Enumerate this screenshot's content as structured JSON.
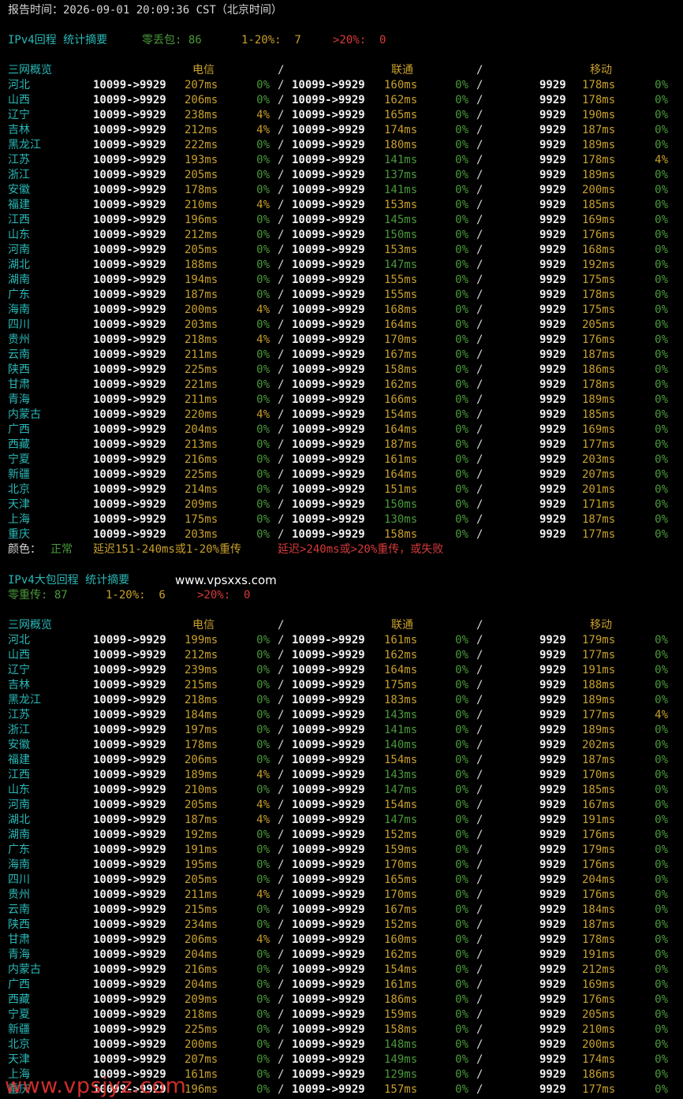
{
  "report_time": "报告时间：2026-09-01 20:09:36 CST（北京时间）",
  "legend": {
    "label": "颜色：",
    "normal": "正常",
    "mid": "延迟151-240ms或1-20%重传",
    "bad": "延迟>240ms或>20%重传，或失败"
  },
  "site_text": "www.vpsxxs.com",
  "watermark": "www.vpsjyz.com",
  "sections": [
    {
      "title": "IPv4回程 统计摘要",
      "summary_inline": true,
      "summary": [
        {
          "text": "零丢包: 86",
          "color": "g"
        },
        {
          "text": "1-20%:  7",
          "color": "y"
        },
        {
          "text": ">20%:  0",
          "color": "r"
        }
      ],
      "header": {
        "name": "三网概览",
        "ct": "电信",
        "sep1": "/",
        "cu": "联通",
        "sep2": "/",
        "cm": "移动"
      },
      "rows": [
        [
          "河北",
          "10099->9929",
          "207ms",
          "0%",
          "10099->9929",
          "160ms",
          "0%",
          "9929",
          "178ms",
          "0%"
        ],
        [
          "山西",
          "10099->9929",
          "206ms",
          "0%",
          "10099->9929",
          "162ms",
          "0%",
          "9929",
          "178ms",
          "0%"
        ],
        [
          "辽宁",
          "10099->9929",
          "238ms",
          "4%",
          "10099->9929",
          "165ms",
          "0%",
          "9929",
          "190ms",
          "0%"
        ],
        [
          "吉林",
          "10099->9929",
          "212ms",
          "4%",
          "10099->9929",
          "174ms",
          "0%",
          "9929",
          "187ms",
          "0%"
        ],
        [
          "黑龙江",
          "10099->9929",
          "222ms",
          "0%",
          "10099->9929",
          "180ms",
          "0%",
          "9929",
          "189ms",
          "0%"
        ],
        [
          "江苏",
          "10099->9929",
          "193ms",
          "0%",
          "10099->9929",
          "141ms",
          "0%",
          "9929",
          "178ms",
          "4%"
        ],
        [
          "浙江",
          "10099->9929",
          "205ms",
          "0%",
          "10099->9929",
          "137ms",
          "0%",
          "9929",
          "189ms",
          "0%"
        ],
        [
          "安徽",
          "10099->9929",
          "178ms",
          "0%",
          "10099->9929",
          "141ms",
          "0%",
          "9929",
          "200ms",
          "0%"
        ],
        [
          "福建",
          "10099->9929",
          "210ms",
          "4%",
          "10099->9929",
          "153ms",
          "0%",
          "9929",
          "185ms",
          "0%"
        ],
        [
          "江西",
          "10099->9929",
          "196ms",
          "0%",
          "10099->9929",
          "145ms",
          "0%",
          "9929",
          "169ms",
          "0%"
        ],
        [
          "山东",
          "10099->9929",
          "212ms",
          "0%",
          "10099->9929",
          "150ms",
          "0%",
          "9929",
          "176ms",
          "0%"
        ],
        [
          "河南",
          "10099->9929",
          "205ms",
          "0%",
          "10099->9929",
          "153ms",
          "0%",
          "9929",
          "168ms",
          "0%"
        ],
        [
          "湖北",
          "10099->9929",
          "188ms",
          "0%",
          "10099->9929",
          "147ms",
          "0%",
          "9929",
          "192ms",
          "0%"
        ],
        [
          "湖南",
          "10099->9929",
          "194ms",
          "0%",
          "10099->9929",
          "155ms",
          "0%",
          "9929",
          "175ms",
          "0%"
        ],
        [
          "广东",
          "10099->9929",
          "187ms",
          "0%",
          "10099->9929",
          "155ms",
          "0%",
          "9929",
          "178ms",
          "0%"
        ],
        [
          "海南",
          "10099->9929",
          "200ms",
          "4%",
          "10099->9929",
          "168ms",
          "0%",
          "9929",
          "175ms",
          "0%"
        ],
        [
          "四川",
          "10099->9929",
          "203ms",
          "0%",
          "10099->9929",
          "164ms",
          "0%",
          "9929",
          "205ms",
          "0%"
        ],
        [
          "贵州",
          "10099->9929",
          "218ms",
          "4%",
          "10099->9929",
          "170ms",
          "0%",
          "9929",
          "176ms",
          "0%"
        ],
        [
          "云南",
          "10099->9929",
          "211ms",
          "0%",
          "10099->9929",
          "167ms",
          "0%",
          "9929",
          "187ms",
          "0%"
        ],
        [
          "陕西",
          "10099->9929",
          "225ms",
          "0%",
          "10099->9929",
          "158ms",
          "0%",
          "9929",
          "186ms",
          "0%"
        ],
        [
          "甘肃",
          "10099->9929",
          "221ms",
          "0%",
          "10099->9929",
          "162ms",
          "0%",
          "9929",
          "178ms",
          "0%"
        ],
        [
          "青海",
          "10099->9929",
          "211ms",
          "0%",
          "10099->9929",
          "166ms",
          "0%",
          "9929",
          "189ms",
          "0%"
        ],
        [
          "内蒙古",
          "10099->9929",
          "220ms",
          "4%",
          "10099->9929",
          "154ms",
          "0%",
          "9929",
          "185ms",
          "0%"
        ],
        [
          "广西",
          "10099->9929",
          "204ms",
          "0%",
          "10099->9929",
          "164ms",
          "0%",
          "9929",
          "169ms",
          "0%"
        ],
        [
          "西藏",
          "10099->9929",
          "213ms",
          "0%",
          "10099->9929",
          "187ms",
          "0%",
          "9929",
          "177ms",
          "0%"
        ],
        [
          "宁夏",
          "10099->9929",
          "216ms",
          "0%",
          "10099->9929",
          "161ms",
          "0%",
          "9929",
          "203ms",
          "0%"
        ],
        [
          "新疆",
          "10099->9929",
          "225ms",
          "0%",
          "10099->9929",
          "164ms",
          "0%",
          "9929",
          "207ms",
          "0%"
        ],
        [
          "北京",
          "10099->9929",
          "214ms",
          "0%",
          "10099->9929",
          "151ms",
          "0%",
          "9929",
          "201ms",
          "0%"
        ],
        [
          "天津",
          "10099->9929",
          "209ms",
          "0%",
          "10099->9929",
          "150ms",
          "0%",
          "9929",
          "171ms",
          "0%"
        ],
        [
          "上海",
          "10099->9929",
          "175ms",
          "0%",
          "10099->9929",
          "130ms",
          "0%",
          "9929",
          "187ms",
          "0%"
        ],
        [
          "重庆",
          "10099->9929",
          "203ms",
          "0%",
          "10099->9929",
          "158ms",
          "0%",
          "9929",
          "177ms",
          "0%"
        ]
      ]
    },
    {
      "title": "IPv4大包回程 统计摘要",
      "summary_inline": false,
      "summary": [
        {
          "text": "零重传: 87",
          "color": "g"
        },
        {
          "text": "1-20%:  6",
          "color": "y"
        },
        {
          "text": ">20%:  0",
          "color": "r"
        }
      ],
      "header": {
        "name": "三网概览",
        "ct": "电信",
        "sep1": "/",
        "cu": "联通",
        "sep2": "/",
        "cm": "移动"
      },
      "rows": [
        [
          "河北",
          "10099->9929",
          "199ms",
          "0%",
          "10099->9929",
          "161ms",
          "0%",
          "9929",
          "179ms",
          "0%"
        ],
        [
          "山西",
          "10099->9929",
          "212ms",
          "0%",
          "10099->9929",
          "162ms",
          "0%",
          "9929",
          "177ms",
          "0%"
        ],
        [
          "辽宁",
          "10099->9929",
          "239ms",
          "0%",
          "10099->9929",
          "164ms",
          "0%",
          "9929",
          "191ms",
          "0%"
        ],
        [
          "吉林",
          "10099->9929",
          "215ms",
          "0%",
          "10099->9929",
          "175ms",
          "0%",
          "9929",
          "188ms",
          "0%"
        ],
        [
          "黑龙江",
          "10099->9929",
          "218ms",
          "0%",
          "10099->9929",
          "183ms",
          "0%",
          "9929",
          "189ms",
          "0%"
        ],
        [
          "江苏",
          "10099->9929",
          "184ms",
          "0%",
          "10099->9929",
          "143ms",
          "0%",
          "9929",
          "177ms",
          "4%"
        ],
        [
          "浙江",
          "10099->9929",
          "197ms",
          "0%",
          "10099->9929",
          "141ms",
          "0%",
          "9929",
          "189ms",
          "0%"
        ],
        [
          "安徽",
          "10099->9929",
          "178ms",
          "0%",
          "10099->9929",
          "140ms",
          "0%",
          "9929",
          "202ms",
          "0%"
        ],
        [
          "福建",
          "10099->9929",
          "206ms",
          "0%",
          "10099->9929",
          "154ms",
          "0%",
          "9929",
          "187ms",
          "0%"
        ],
        [
          "江西",
          "10099->9929",
          "189ms",
          "4%",
          "10099->9929",
          "143ms",
          "0%",
          "9929",
          "170ms",
          "0%"
        ],
        [
          "山东",
          "10099->9929",
          "210ms",
          "0%",
          "10099->9929",
          "147ms",
          "0%",
          "9929",
          "185ms",
          "0%"
        ],
        [
          "河南",
          "10099->9929",
          "205ms",
          "4%",
          "10099->9929",
          "154ms",
          "0%",
          "9929",
          "167ms",
          "0%"
        ],
        [
          "湖北",
          "10099->9929",
          "187ms",
          "4%",
          "10099->9929",
          "147ms",
          "0%",
          "9929",
          "191ms",
          "0%"
        ],
        [
          "湖南",
          "10099->9929",
          "192ms",
          "0%",
          "10099->9929",
          "152ms",
          "0%",
          "9929",
          "176ms",
          "0%"
        ],
        [
          "广东",
          "10099->9929",
          "191ms",
          "0%",
          "10099->9929",
          "159ms",
          "0%",
          "9929",
          "179ms",
          "0%"
        ],
        [
          "海南",
          "10099->9929",
          "195ms",
          "0%",
          "10099->9929",
          "170ms",
          "0%",
          "9929",
          "176ms",
          "0%"
        ],
        [
          "四川",
          "10099->9929",
          "205ms",
          "0%",
          "10099->9929",
          "165ms",
          "0%",
          "9929",
          "204ms",
          "0%"
        ],
        [
          "贵州",
          "10099->9929",
          "211ms",
          "4%",
          "10099->9929",
          "170ms",
          "0%",
          "9929",
          "176ms",
          "0%"
        ],
        [
          "云南",
          "10099->9929",
          "215ms",
          "0%",
          "10099->9929",
          "167ms",
          "0%",
          "9929",
          "184ms",
          "0%"
        ],
        [
          "陕西",
          "10099->9929",
          "234ms",
          "0%",
          "10099->9929",
          "152ms",
          "0%",
          "9929",
          "187ms",
          "0%"
        ],
        [
          "甘肃",
          "10099->9929",
          "206ms",
          "4%",
          "10099->9929",
          "160ms",
          "0%",
          "9929",
          "178ms",
          "0%"
        ],
        [
          "青海",
          "10099->9929",
          "204ms",
          "0%",
          "10099->9929",
          "162ms",
          "0%",
          "9929",
          "191ms",
          "0%"
        ],
        [
          "内蒙古",
          "10099->9929",
          "216ms",
          "0%",
          "10099->9929",
          "154ms",
          "0%",
          "9929",
          "212ms",
          "0%"
        ],
        [
          "广西",
          "10099->9929",
          "204ms",
          "0%",
          "10099->9929",
          "161ms",
          "0%",
          "9929",
          "169ms",
          "0%"
        ],
        [
          "西藏",
          "10099->9929",
          "209ms",
          "0%",
          "10099->9929",
          "186ms",
          "0%",
          "9929",
          "176ms",
          "0%"
        ],
        [
          "宁夏",
          "10099->9929",
          "218ms",
          "0%",
          "10099->9929",
          "159ms",
          "0%",
          "9929",
          "205ms",
          "0%"
        ],
        [
          "新疆",
          "10099->9929",
          "225ms",
          "0%",
          "10099->9929",
          "158ms",
          "0%",
          "9929",
          "210ms",
          "0%"
        ],
        [
          "北京",
          "10099->9929",
          "200ms",
          "0%",
          "10099->9929",
          "148ms",
          "0%",
          "9929",
          "200ms",
          "0%"
        ],
        [
          "天津",
          "10099->9929",
          "207ms",
          "0%",
          "10099->9929",
          "149ms",
          "0%",
          "9929",
          "174ms",
          "0%"
        ],
        [
          "上海",
          "10099->9929",
          "161ms",
          "0%",
          "10099->9929",
          "129ms",
          "0%",
          "9929",
          "186ms",
          "0%"
        ],
        [
          "重庆",
          "10099->9929",
          "196ms",
          "0%",
          "10099->9929",
          "157ms",
          "0%",
          "9929",
          "177ms",
          "0%"
        ]
      ]
    }
  ]
}
